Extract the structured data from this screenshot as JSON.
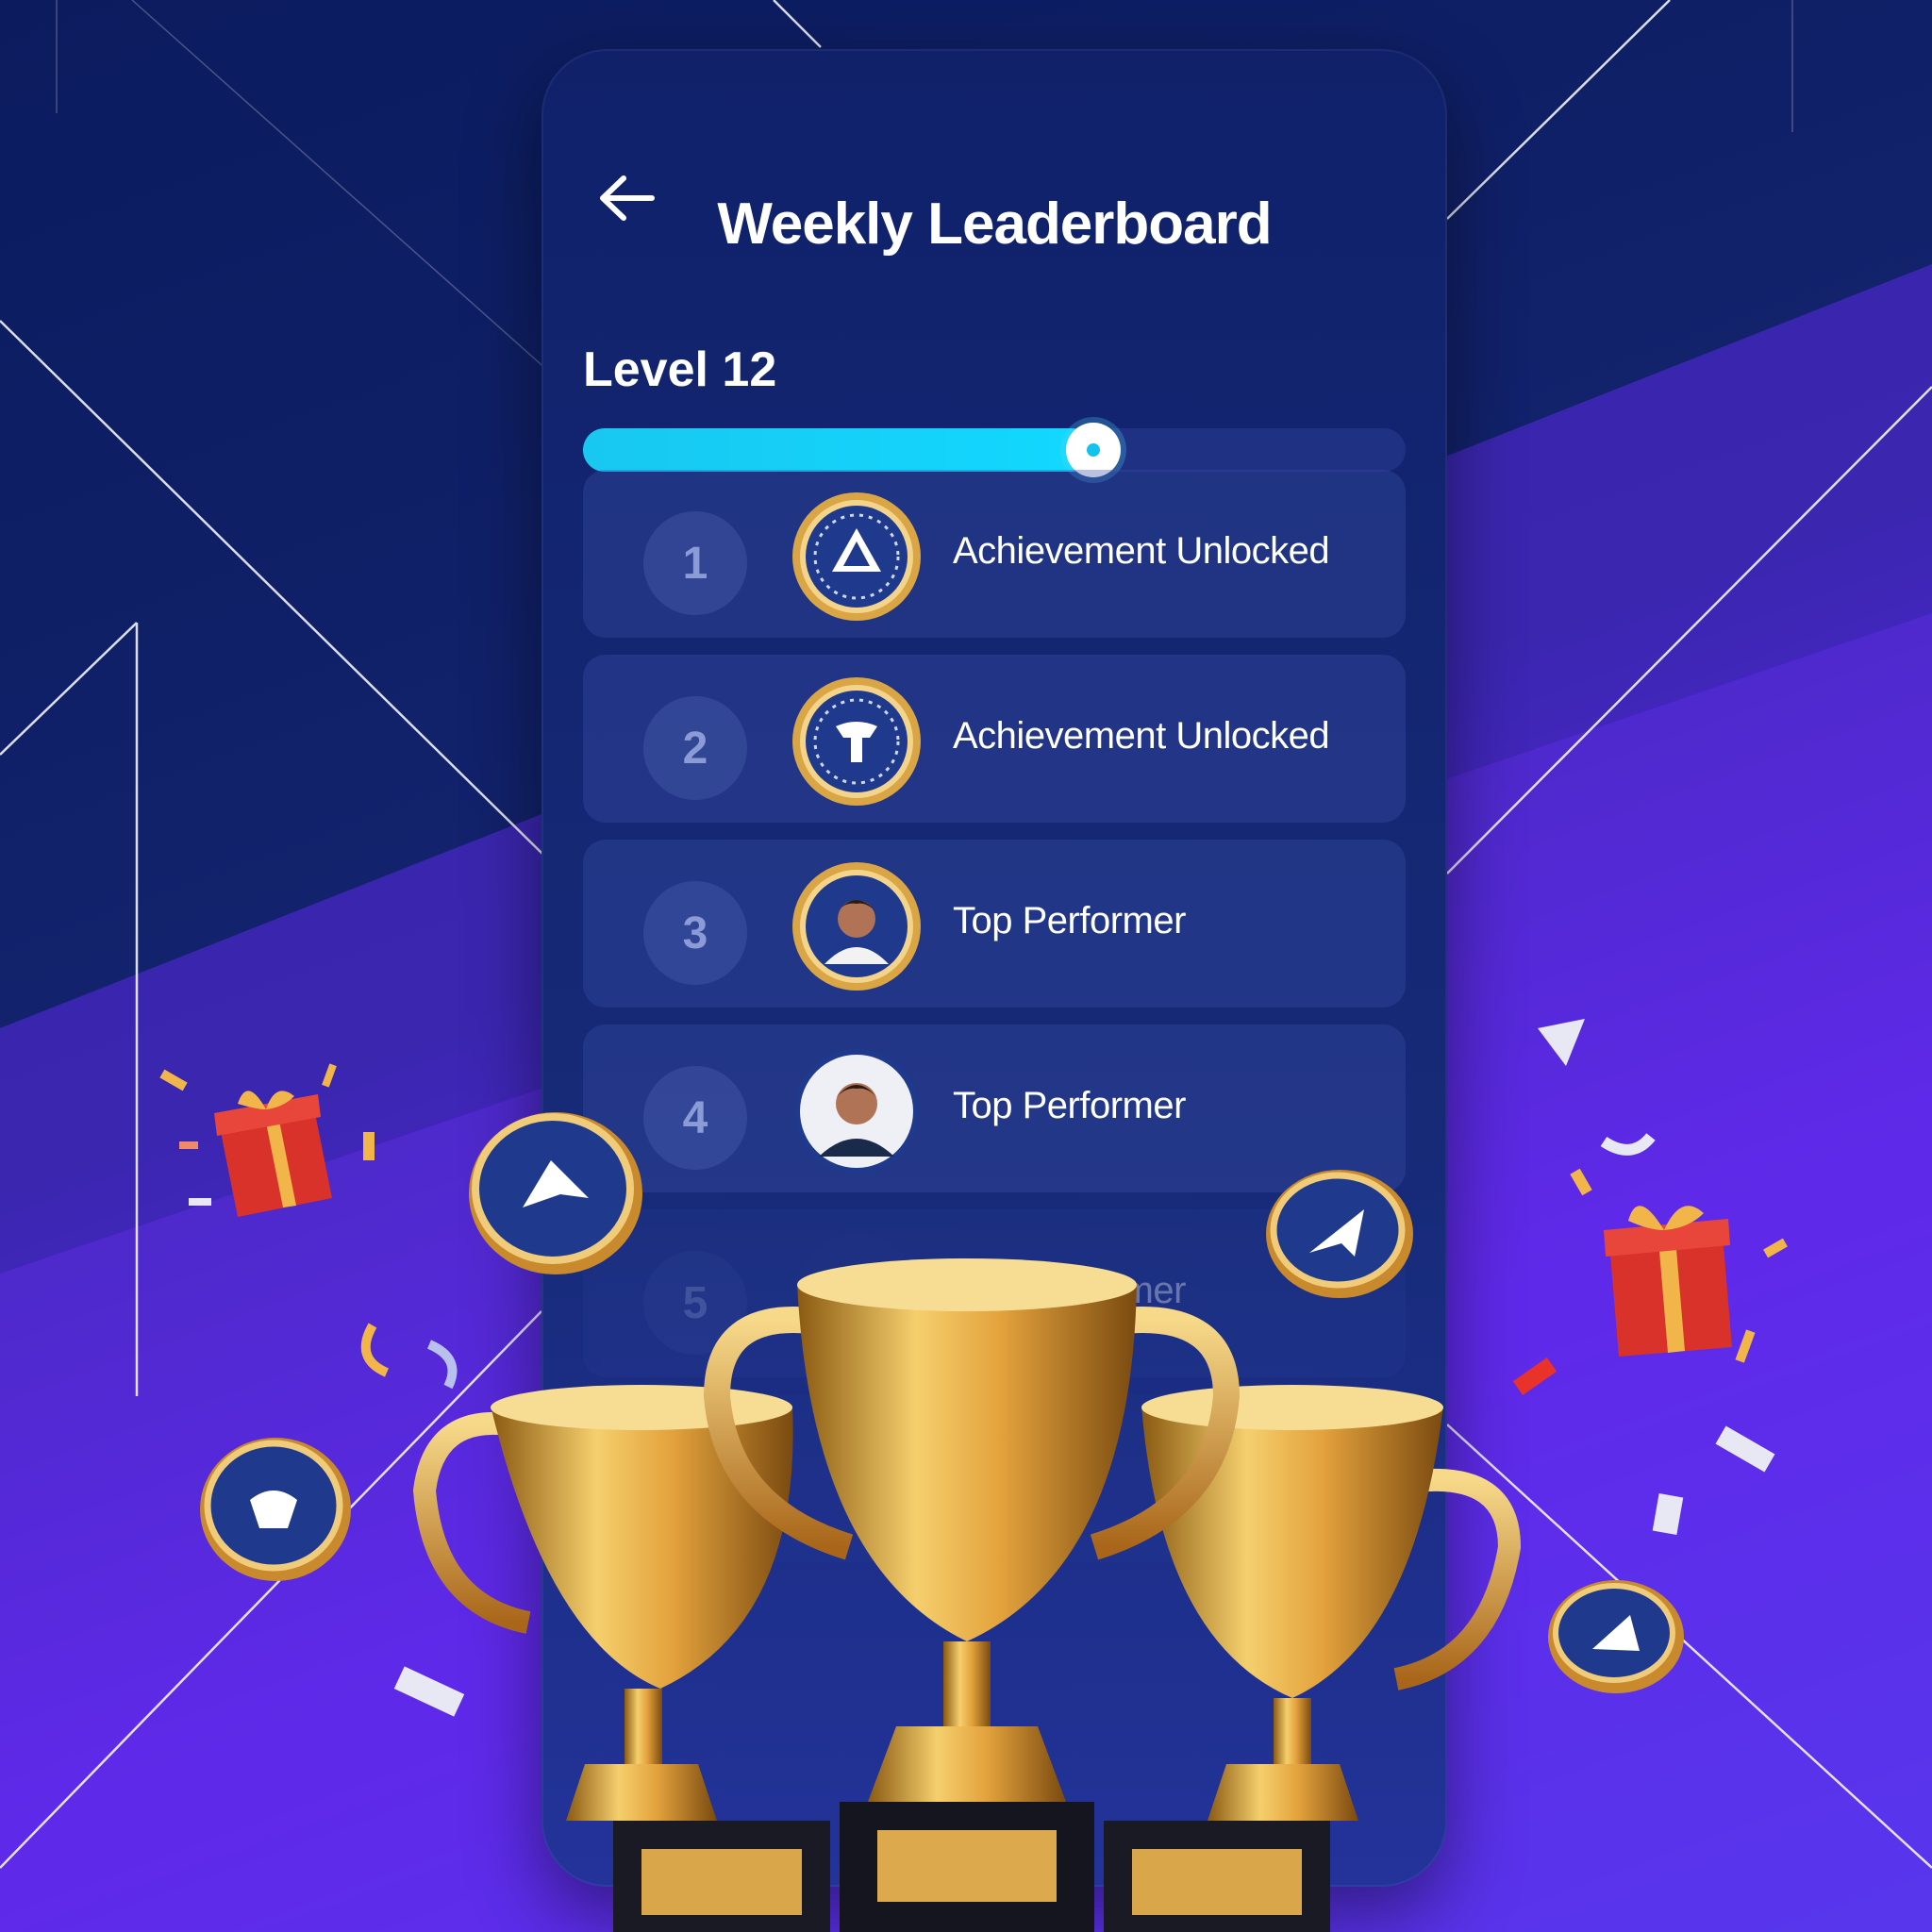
{
  "header": {
    "title": "Weekly Leaderboard"
  },
  "level": {
    "label": "Level 12",
    "progress": 0.62
  },
  "leaderboard": [
    {
      "rank": "1",
      "label": "Achievement Unlocked",
      "badge": "triangle-medal-icon"
    },
    {
      "rank": "2",
      "label": "Achievement Unlocked",
      "badge": "cross-medal-icon"
    },
    {
      "rank": "3",
      "label": "Top Performer",
      "badge": "avatar-medal-icon"
    },
    {
      "rank": "4",
      "label": "Top Performer",
      "badge": "avatar-icon"
    },
    {
      "rank": "5",
      "label": "Top Performer",
      "badge": "avatar-icon"
    }
  ],
  "colors": {
    "accent": "#12d8ff",
    "gold": "#e0a93a",
    "panel": "#12236e"
  }
}
